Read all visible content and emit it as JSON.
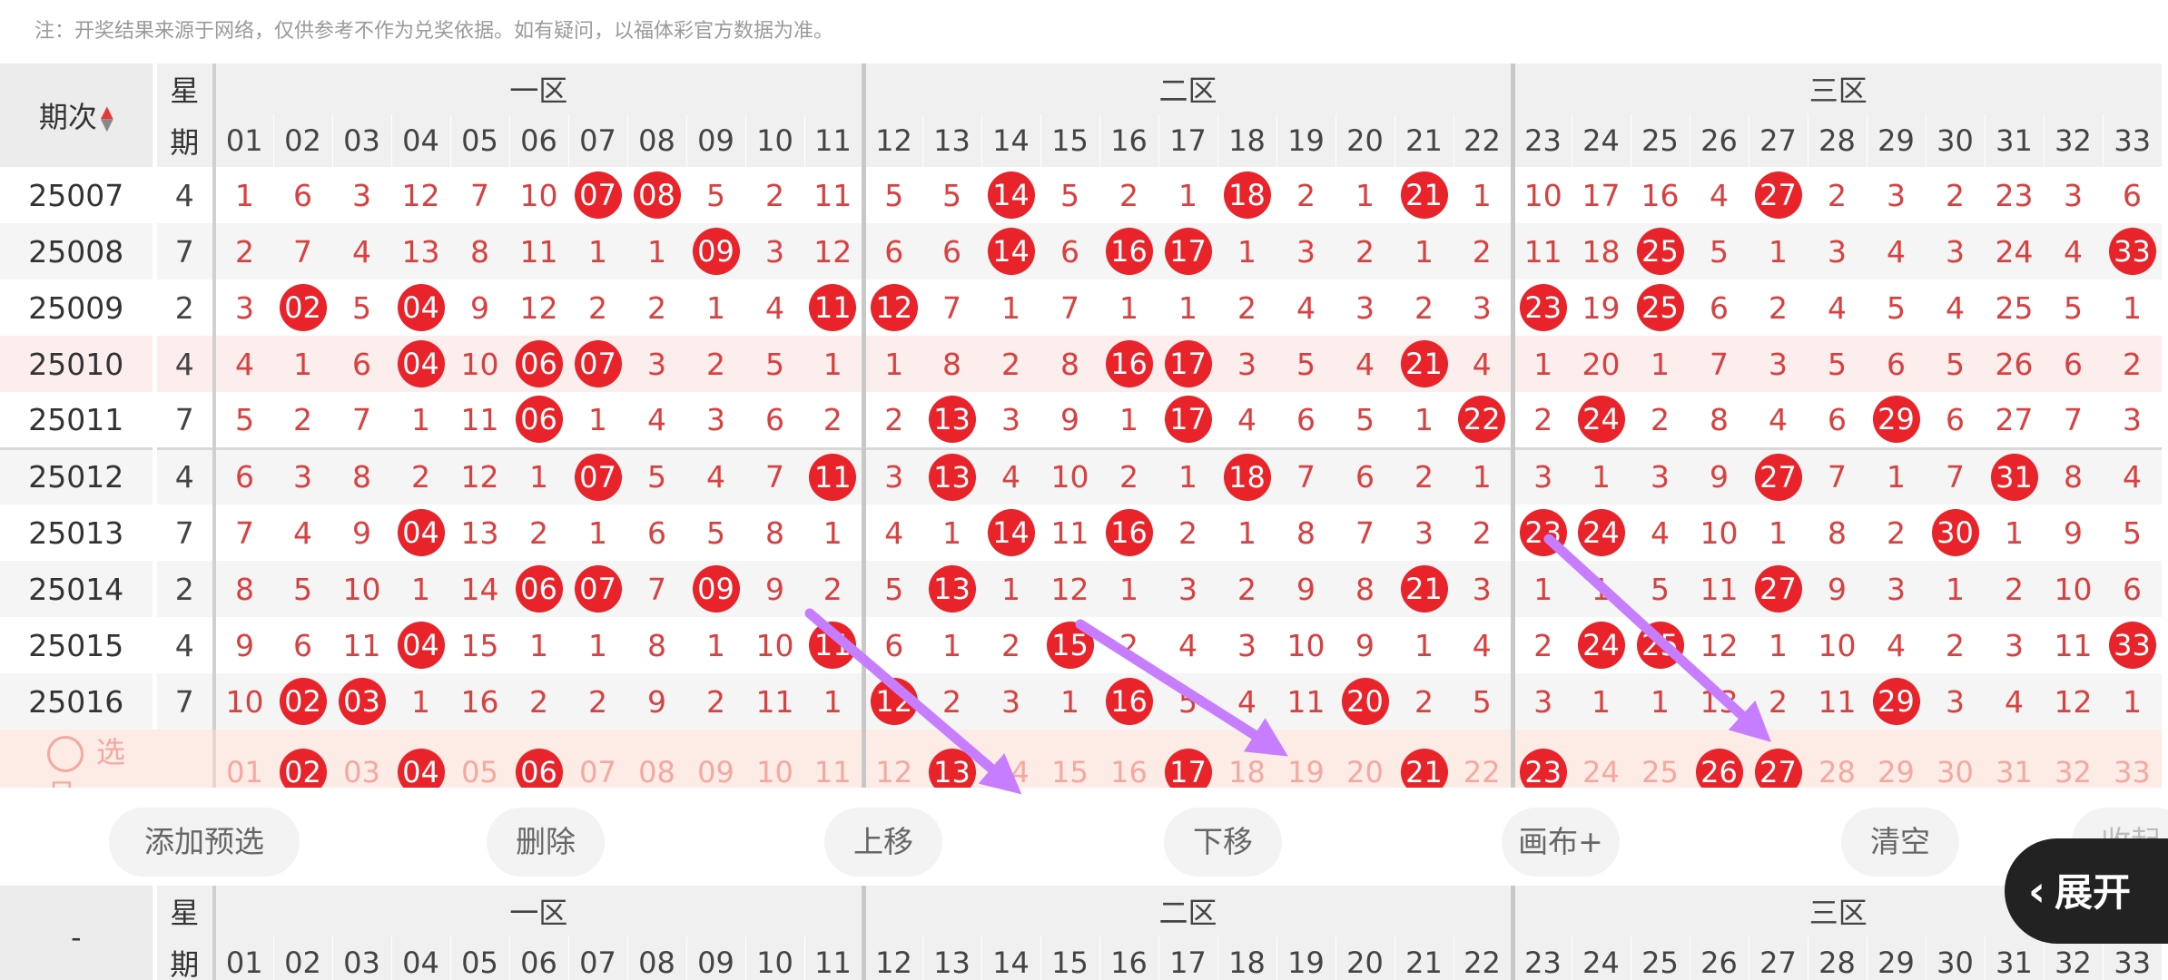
{
  "note": "注：开奖结果来源于网络，仅供参考不作为兑奖依据。如有疑问，以福体彩官方数据为准。",
  "header": {
    "issue_label": "期次",
    "week_label_1": "星",
    "week_label_2": "期",
    "zones": [
      "一区",
      "二区",
      "三区"
    ],
    "numbers": [
      "01",
      "02",
      "03",
      "04",
      "05",
      "06",
      "07",
      "08",
      "09",
      "10",
      "11",
      "12",
      "13",
      "14",
      "15",
      "16",
      "17",
      "18",
      "19",
      "20",
      "21",
      "22",
      "23",
      "24",
      "25",
      "26",
      "27",
      "28",
      "29",
      "30",
      "31",
      "32",
      "33"
    ]
  },
  "rows": [
    {
      "issue": "25007",
      "week": "4",
      "cells": [
        "1",
        "6",
        "3",
        "12",
        "7",
        "10",
        "07",
        "08",
        "5",
        "2",
        "11",
        "5",
        "5",
        "14",
        "5",
        "2",
        "1",
        "18",
        "2",
        "1",
        "21",
        "1",
        "10",
        "17",
        "16",
        "4",
        "27",
        "2",
        "3",
        "2",
        "23",
        "3",
        "6"
      ],
      "balls": [
        7,
        8,
        14,
        18,
        21,
        27
      ]
    },
    {
      "issue": "25008",
      "week": "7",
      "cells": [
        "2",
        "7",
        "4",
        "13",
        "8",
        "11",
        "1",
        "1",
        "09",
        "3",
        "12",
        "6",
        "6",
        "14",
        "6",
        "16",
        "17",
        "1",
        "3",
        "2",
        "1",
        "2",
        "11",
        "18",
        "25",
        "5",
        "1",
        "3",
        "4",
        "3",
        "24",
        "4",
        "33"
      ],
      "balls": [
        9,
        14,
        16,
        17,
        25,
        33
      ]
    },
    {
      "issue": "25009",
      "week": "2",
      "cells": [
        "3",
        "02",
        "5",
        "04",
        "9",
        "12",
        "2",
        "2",
        "1",
        "4",
        "11",
        "12",
        "7",
        "1",
        "7",
        "1",
        "1",
        "2",
        "4",
        "3",
        "2",
        "3",
        "23",
        "19",
        "25",
        "6",
        "2",
        "4",
        "5",
        "4",
        "25",
        "5",
        "1"
      ],
      "balls": [
        2,
        4,
        11,
        12,
        23,
        25
      ]
    },
    {
      "issue": "25010",
      "week": "4",
      "cells": [
        "4",
        "1",
        "6",
        "04",
        "10",
        "06",
        "07",
        "3",
        "2",
        "5",
        "1",
        "1",
        "8",
        "2",
        "8",
        "16",
        "17",
        "3",
        "5",
        "4",
        "21",
        "4",
        "1",
        "20",
        "1",
        "7",
        "3",
        "5",
        "6",
        "5",
        "26",
        "6",
        "2"
      ],
      "balls": [
        4,
        6,
        7,
        16,
        17,
        21
      ]
    },
    {
      "issue": "25011",
      "week": "7",
      "cells": [
        "5",
        "2",
        "7",
        "1",
        "11",
        "06",
        "1",
        "4",
        "3",
        "6",
        "2",
        "2",
        "13",
        "3",
        "9",
        "1",
        "17",
        "4",
        "6",
        "5",
        "1",
        "22",
        "2",
        "24",
        "2",
        "8",
        "4",
        "6",
        "29",
        "6",
        "27",
        "7",
        "3"
      ],
      "balls": [
        6,
        13,
        17,
        22,
        24,
        29
      ]
    },
    {
      "issue": "25012",
      "week": "4",
      "cells": [
        "6",
        "3",
        "8",
        "2",
        "12",
        "1",
        "07",
        "5",
        "4",
        "7",
        "11",
        "3",
        "13",
        "4",
        "10",
        "2",
        "1",
        "18",
        "7",
        "6",
        "2",
        "1",
        "3",
        "1",
        "3",
        "9",
        "27",
        "7",
        "1",
        "7",
        "31",
        "8",
        "4"
      ],
      "balls": [
        7,
        11,
        13,
        18,
        27,
        31
      ]
    },
    {
      "issue": "25013",
      "week": "7",
      "cells": [
        "7",
        "4",
        "9",
        "04",
        "13",
        "2",
        "1",
        "6",
        "5",
        "8",
        "1",
        "4",
        "1",
        "14",
        "11",
        "16",
        "2",
        "1",
        "8",
        "7",
        "3",
        "2",
        "23",
        "24",
        "4",
        "10",
        "1",
        "8",
        "2",
        "30",
        "1",
        "9",
        "5"
      ],
      "balls": [
        4,
        14,
        16,
        23,
        24,
        30
      ]
    },
    {
      "issue": "25014",
      "week": "2",
      "cells": [
        "8",
        "5",
        "10",
        "1",
        "14",
        "06",
        "07",
        "7",
        "09",
        "9",
        "2",
        "5",
        "13",
        "1",
        "12",
        "1",
        "3",
        "2",
        "9",
        "8",
        "21",
        "3",
        "1",
        "1",
        "5",
        "11",
        "27",
        "9",
        "3",
        "1",
        "2",
        "10",
        "6"
      ],
      "balls": [
        6,
        7,
        9,
        13,
        21,
        27
      ]
    },
    {
      "issue": "25015",
      "week": "4",
      "cells": [
        "9",
        "6",
        "11",
        "04",
        "15",
        "1",
        "1",
        "8",
        "1",
        "10",
        "11",
        "6",
        "1",
        "2",
        "15",
        "2",
        "4",
        "3",
        "10",
        "9",
        "1",
        "4",
        "2",
        "24",
        "25",
        "12",
        "1",
        "10",
        "4",
        "2",
        "3",
        "11",
        "33"
      ],
      "balls": [
        4,
        11,
        15,
        24,
        25,
        33
      ]
    },
    {
      "issue": "25016",
      "week": "7",
      "cells": [
        "10",
        "02",
        "03",
        "1",
        "16",
        "2",
        "2",
        "9",
        "2",
        "11",
        "1",
        "12",
        "2",
        "3",
        "1",
        "16",
        "5",
        "4",
        "11",
        "20",
        "2",
        "5",
        "3",
        "1",
        "1",
        "13",
        "2",
        "11",
        "29",
        "3",
        "4",
        "12",
        "1"
      ],
      "balls": [
        2,
        3,
        12,
        16,
        20,
        29
      ]
    }
  ],
  "pick_row": {
    "label": "选号",
    "cells": [
      "01",
      "02",
      "03",
      "04",
      "05",
      "06",
      "07",
      "08",
      "09",
      "10",
      "11",
      "12",
      "13",
      "14",
      "15",
      "16",
      "17",
      "18",
      "19",
      "20",
      "21",
      "22",
      "23",
      "24",
      "25",
      "26",
      "27",
      "28",
      "29",
      "30",
      "31",
      "32",
      "33"
    ],
    "selected": [
      2,
      4,
      6,
      13,
      17,
      21,
      23,
      26,
      27
    ]
  },
  "toolbar": {
    "add": "添加预选",
    "delete": "删除",
    "up": "上移",
    "down": "下移",
    "canvas": "画布+",
    "clear": "清空",
    "collapse": "收起"
  },
  "expand_label": "展开",
  "second_table": {
    "issue_label": "-"
  },
  "colors": {
    "ball": "#e8232a",
    "arrow": "#c77dff"
  }
}
